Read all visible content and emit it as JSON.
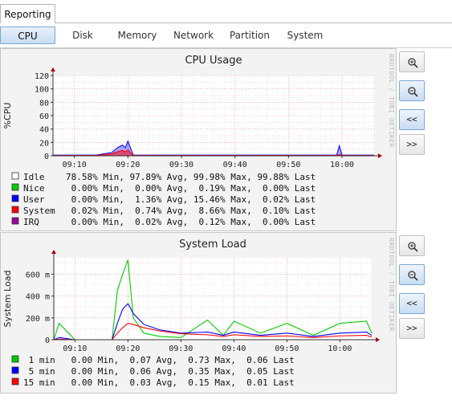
{
  "tabs": {
    "reporting": "Reporting"
  },
  "subtabs": [
    "CPU",
    "Disk",
    "Memory",
    "Network",
    "Partition",
    "System"
  ],
  "buttons": {
    "back": "<<",
    "forward": ">>"
  },
  "watermark": "RRDTOOL / TOBI OETIKER",
  "graphs": [
    {
      "title": "CPU Usage",
      "ylabel": "%CPU",
      "x_ticks": [
        "09:10",
        "09:20",
        "09:30",
        "09:40",
        "09:50",
        "10:00"
      ],
      "y_ticks": [
        "0",
        "20",
        "40",
        "60",
        "80",
        "100",
        "120"
      ],
      "legend": [
        {
          "name": "Idle",
          "color": "#ffffff",
          "min": "78.58%",
          "avg": "97.89%",
          "max": "99.98%",
          "last": "99.88%"
        },
        {
          "name": "Nice",
          "color": "#00cc00",
          "min": "0.00%",
          "avg": "0.00%",
          "max": "0.19%",
          "last": "0.00%"
        },
        {
          "name": "User",
          "color": "#0000ff",
          "min": "0.00%",
          "avg": "1.36%",
          "max": "15.46%",
          "last": "0.02%"
        },
        {
          "name": "System",
          "color": "#ff0000",
          "min": "0.02%",
          "avg": "0.74%",
          "max": "8.66%",
          "last": "0.10%"
        },
        {
          "name": "IRQ",
          "color": "#990099",
          "min": "0.00%",
          "avg": "0.02%",
          "max": "0.12%",
          "last": "0.00%"
        }
      ]
    },
    {
      "title": "System Load",
      "ylabel": "System Load",
      "x_ticks": [
        "09:10",
        "09:20",
        "09:30",
        "09:40",
        "09:50",
        "10:00"
      ],
      "y_ticks": [
        "0",
        "200 m",
        "400 m",
        "600 m"
      ],
      "legend": [
        {
          "name": " 1 min",
          "color": "#00cc00",
          "min": "0.00",
          "avg": "0.07",
          "max": "0.73",
          "last": "0.06"
        },
        {
          "name": " 5 min",
          "color": "#0000ff",
          "min": "0.00",
          "avg": "0.06",
          "max": "0.35",
          "last": "0.05"
        },
        {
          "name": "15 min",
          "color": "#ff0000",
          "min": "0.00",
          "avg": "0.03",
          "max": "0.15",
          "last": "0.01"
        }
      ]
    }
  ],
  "chart_data": [
    {
      "type": "area",
      "title": "CPU Usage",
      "ylabel": "%CPU",
      "ylim": [
        0,
        120
      ],
      "x": [
        "09:06",
        "09:10",
        "09:14",
        "09:17",
        "09:18",
        "09:19",
        "09:19.5",
        "09:20",
        "09:21",
        "09:25",
        "09:30",
        "09:40",
        "09:50",
        "09:59",
        "09:59.5",
        "10:00",
        "10:06"
      ],
      "series": [
        {
          "name": "User",
          "values": [
            1,
            1,
            1,
            5,
            12,
            16,
            12,
            22,
            1,
            1,
            1,
            1,
            1,
            1,
            15,
            1,
            1
          ]
        },
        {
          "name": "System",
          "values": [
            0.5,
            0.5,
            0.5,
            3,
            6,
            8,
            6,
            9,
            0.5,
            0.5,
            0.5,
            0.5,
            0.5,
            0.5,
            2,
            0.5,
            0.5
          ]
        }
      ]
    },
    {
      "type": "line",
      "title": "System Load",
      "ylabel": "System Load",
      "ylim": [
        0,
        750
      ],
      "x": [
        "09:06",
        "09:07",
        "09:10",
        "09:12",
        "09:15",
        "09:17",
        "09:18",
        "09:19",
        "09:20",
        "09:21",
        "09:23",
        "09:26",
        "09:30",
        "09:35",
        "09:38",
        "09:40",
        "09:45",
        "09:50",
        "09:55",
        "10:00",
        "10:05",
        "10:06"
      ],
      "series": [
        {
          "name": "1 min",
          "values": [
            0,
            150,
            0,
            0,
            0,
            0,
            450,
            600,
            730,
            200,
            60,
            30,
            20,
            180,
            40,
            170,
            60,
            150,
            40,
            150,
            170,
            60
          ]
        },
        {
          "name": "5 min",
          "values": [
            0,
            20,
            0,
            0,
            0,
            0,
            150,
            280,
            330,
            240,
            140,
            90,
            60,
            70,
            40,
            70,
            40,
            60,
            30,
            60,
            70,
            40
          ]
        },
        {
          "name": "15 min",
          "values": [
            0,
            5,
            0,
            0,
            0,
            0,
            60,
            110,
            150,
            140,
            110,
            80,
            55,
            45,
            30,
            45,
            30,
            35,
            20,
            35,
            40,
            25
          ]
        }
      ]
    }
  ]
}
